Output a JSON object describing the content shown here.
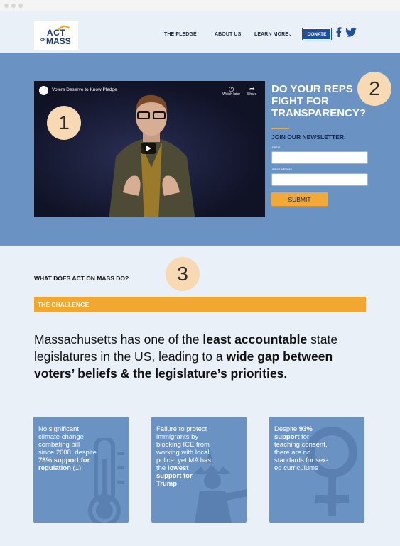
{
  "header": {
    "logo": {
      "act": "ACT",
      "on": "ON",
      "mass": "MASS"
    },
    "nav": {
      "pledge": "THE PLEDGE",
      "about": "ABOUT US",
      "learn": "LEARN MORE",
      "donate": "DONATE"
    },
    "social": [
      "facebook-icon",
      "twitter-icon"
    ]
  },
  "hero": {
    "video": {
      "title": "Voters Deserve to Know Pledge",
      "watch_later": "Watch later",
      "share": "Share"
    },
    "headline": "DO YOUR REPS FIGHT FOR TRANSPARENCY?",
    "newsletter_label": "JOIN OUR NEWSLETTER:",
    "name_label": "name",
    "email_label": "email address",
    "name_value": "",
    "email_value": "",
    "submit_label": "SUBMIT"
  },
  "annotations": [
    "1",
    "2",
    "3"
  ],
  "section": {
    "title": "WHAT DOES ACT ON MASS DO?",
    "challenge": "THE CHALLENGE",
    "lead": {
      "p1": "Massachusetts has one of the ",
      "b1": "least accountable",
      "p2": " state legislatures in the US, leading to a ",
      "b2": "wide gap between voters’ beliefs & the legislature’s priorities."
    }
  },
  "cards": [
    {
      "t1": "No significant climate change combating bill since 2008, despite ",
      "b1": "78% support for regulation",
      "t2": " (1)",
      "icon": "thermometer-icon"
    },
    {
      "t1": "Failure to protect immigrants by blocking ICE from working with local police, yet MA has the ",
      "b1": "lowest support for Trump",
      "t2": "",
      "icon": "statue-of-liberty-icon"
    },
    {
      "t1": "Despite ",
      "b1": "93% support",
      "t2": " for teaching consent, there are no standards for sex-ed curriculums",
      "icon": "female-symbol-icon"
    }
  ],
  "colors": {
    "hero_bg": "#6a92c3",
    "accent": "#f0a833",
    "navy": "#1b3a73",
    "page_bg": "#eaf0f8"
  }
}
